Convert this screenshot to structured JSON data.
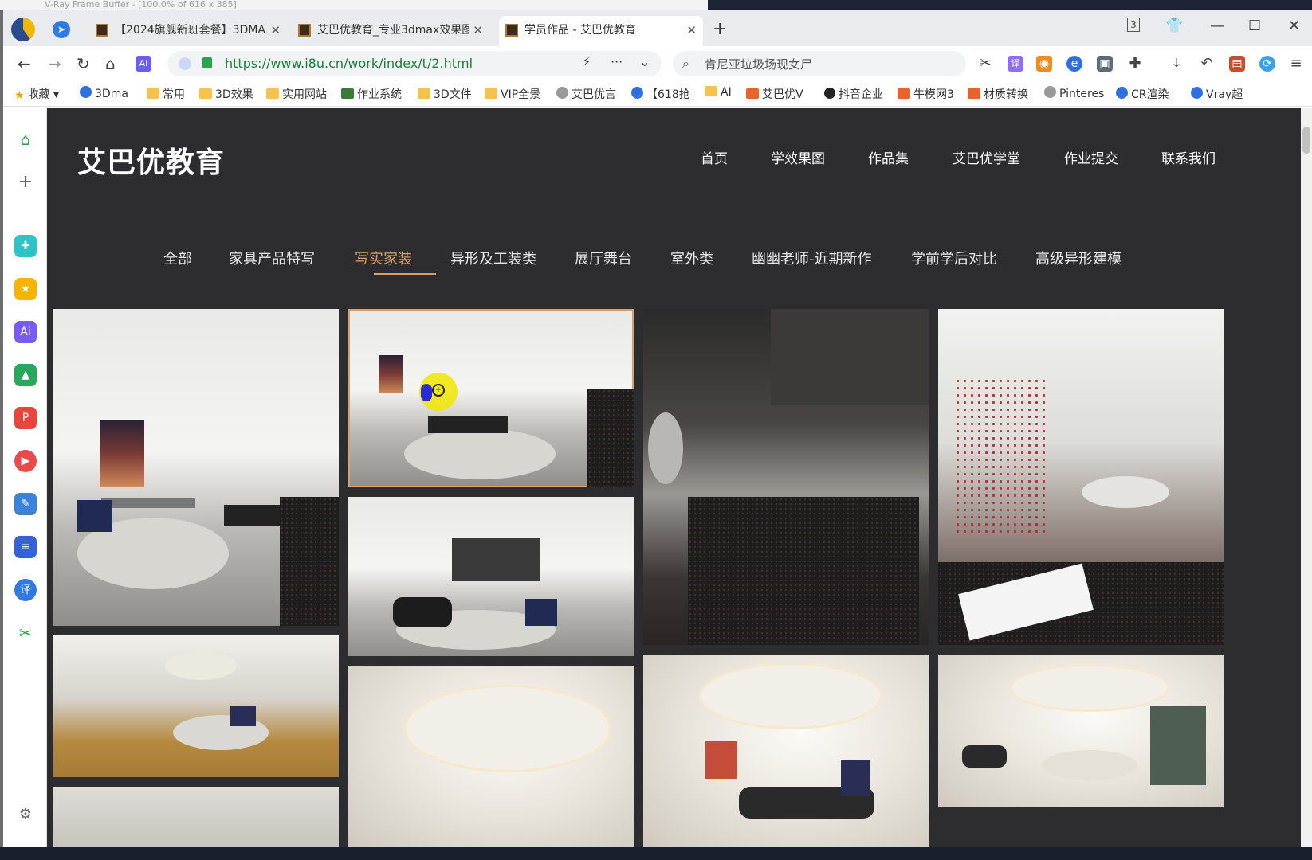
{
  "window": {
    "ghost_title": "V-Ray Frame Buffer - [100.0% of 616 x 385]"
  },
  "tabs": [
    {
      "label": "【2024旗舰新班套餐】3DMA",
      "active": false
    },
    {
      "label": "艾巴优教育_专业3dmax效果图",
      "active": false
    },
    {
      "label": "学员作品 - 艾巴优教育",
      "active": true
    }
  ],
  "tab_badge": "3",
  "address": {
    "url": "https://www.i8u.cn/work/index/t/2.html",
    "search_placeholder": "肯尼亚垃圾场现女尸"
  },
  "bookmarks": [
    {
      "label": "收藏",
      "icon": "star-icon"
    },
    {
      "label": "3Dma",
      "icon": "blue-icon"
    },
    {
      "label": "常用",
      "icon": "folder-icon"
    },
    {
      "label": "3D效果",
      "icon": "folder-icon"
    },
    {
      "label": "实用网站",
      "icon": "folder-icon"
    },
    {
      "label": "作业系统",
      "icon": "site-icon"
    },
    {
      "label": "3D文件",
      "icon": "folder-icon"
    },
    {
      "label": "VIP全景",
      "icon": "folder-icon"
    },
    {
      "label": "艾巴优言",
      "icon": "gray-icon"
    },
    {
      "label": "【618抢",
      "icon": "blue-icon"
    },
    {
      "label": "AI",
      "icon": "folder-icon"
    },
    {
      "label": "艾巴优V",
      "icon": "orange-icon"
    },
    {
      "label": "抖音企业",
      "icon": "tiktok-icon"
    },
    {
      "label": "牛模网3",
      "icon": "orange-icon"
    },
    {
      "label": "材质转换",
      "icon": "orange-icon"
    },
    {
      "label": "Pinteres",
      "icon": "gray-icon"
    },
    {
      "label": "CR渲染",
      "icon": "blue-icon"
    },
    {
      "label": "Vray超",
      "icon": "blue-icon"
    }
  ],
  "site": {
    "logo": "艾巴优教育",
    "nav": [
      "首页",
      "学效果图",
      "作品集",
      "艾巴优学堂",
      "作业提交",
      "联系我们"
    ],
    "categories": [
      "全部",
      "家具产品特写",
      "写实家装",
      "异形及工装类",
      "展厅舞台",
      "室外类",
      "幽幽老师-近期新作",
      "学前学后对比",
      "高级异形建模"
    ],
    "active_category": "写实家装"
  },
  "colors": {
    "page_bg": "#2d2d30",
    "accent": "#d8a06a",
    "url_green": "#188038"
  }
}
